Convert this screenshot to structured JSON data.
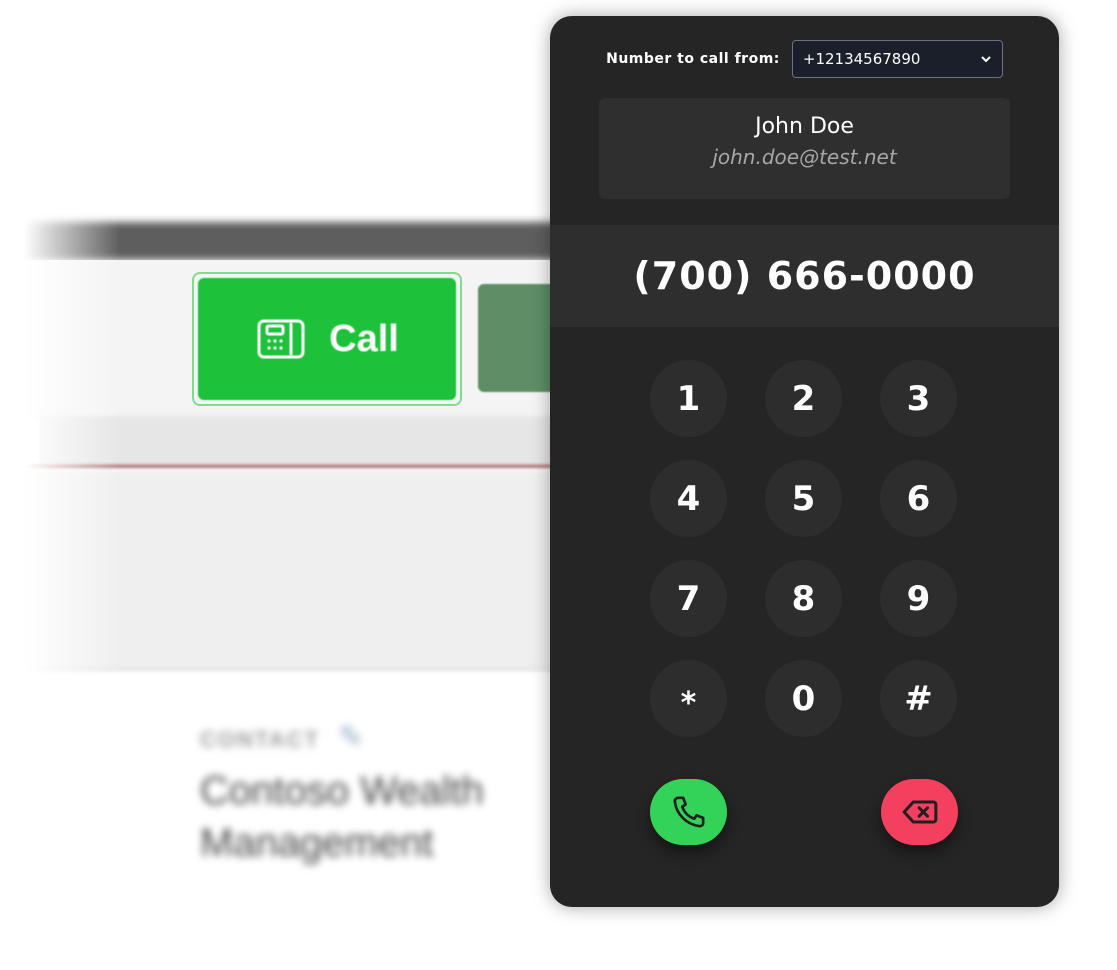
{
  "background_app": {
    "call_button_label": "Call",
    "contact_label": "CONTACT",
    "contact_name": "Contoso Wealth Management"
  },
  "dialer": {
    "from_label": "Number to call from:",
    "from_number": "+12134567890",
    "contact": {
      "name": "John Doe",
      "email": "john.doe@test.net"
    },
    "dialed_number": "(700) 666-0000",
    "keys": [
      "1",
      "2",
      "3",
      "4",
      "5",
      "6",
      "7",
      "8",
      "9",
      "*",
      "0",
      "#"
    ],
    "dial_icon": "phone-icon",
    "backspace_icon": "backspace-icon",
    "colors": {
      "panel": "#252525",
      "dial_button": "#33d35a",
      "backspace_button": "#f43f5e",
      "call_button": "#1dc23a"
    }
  }
}
